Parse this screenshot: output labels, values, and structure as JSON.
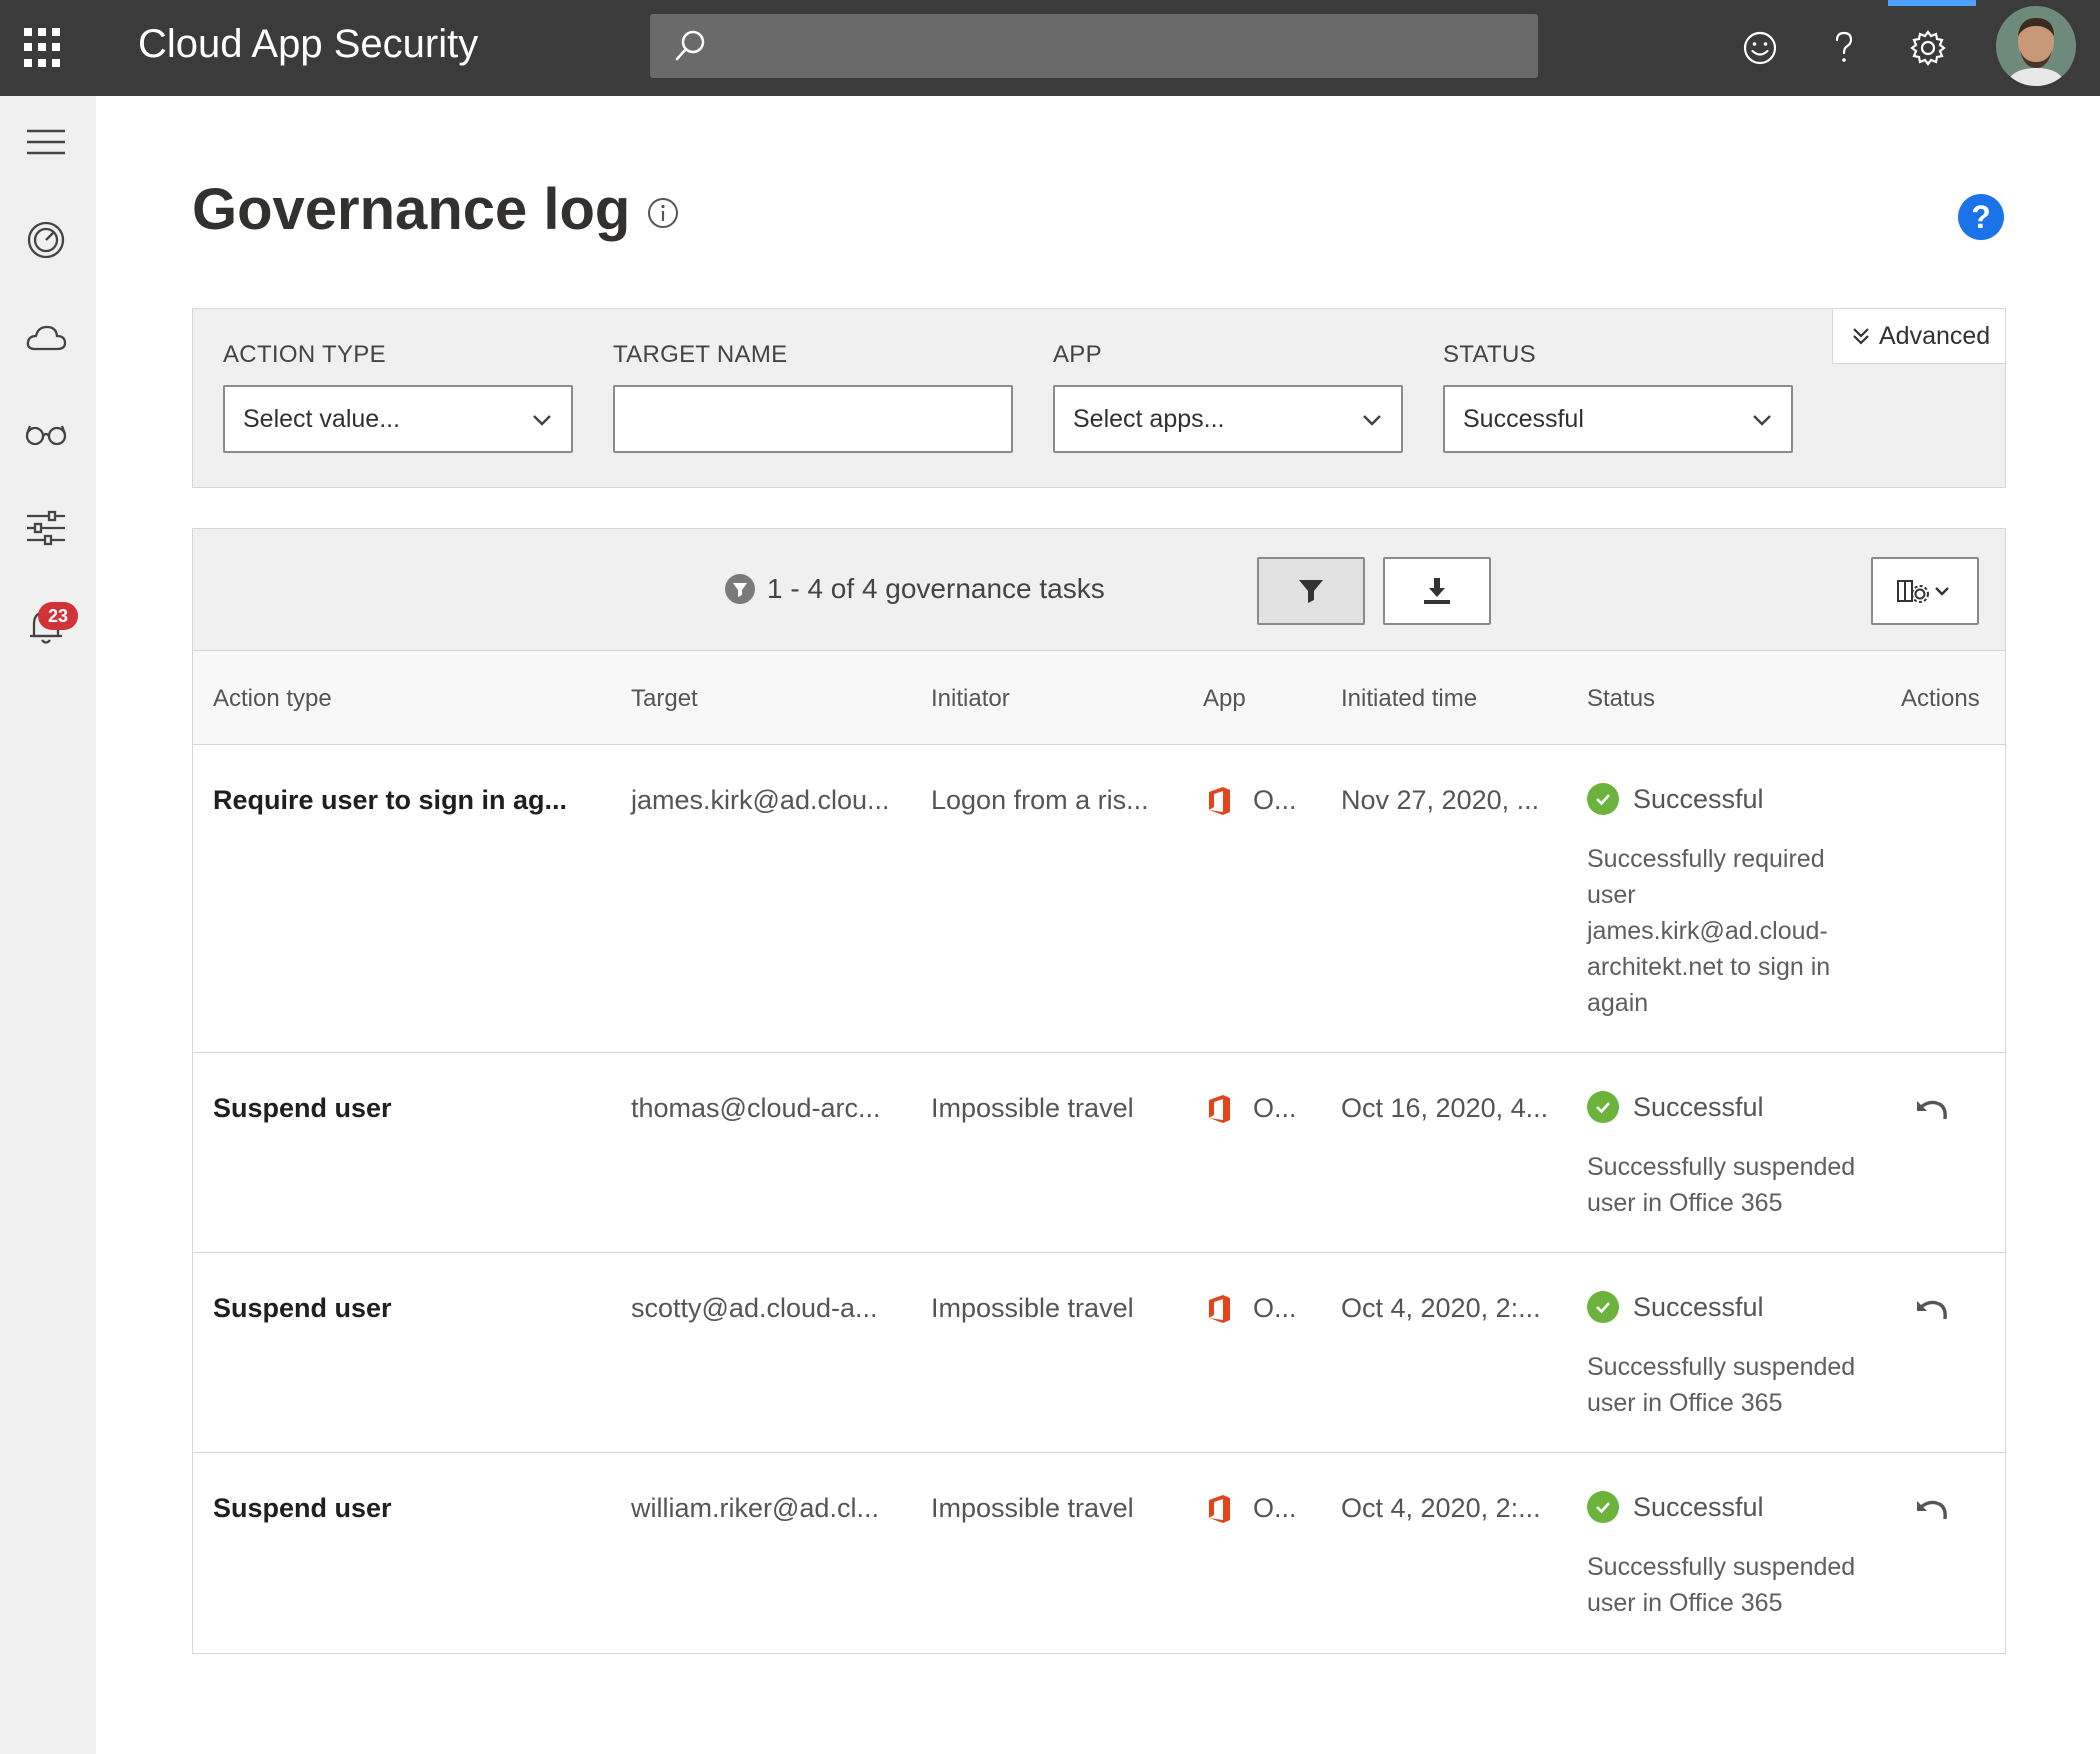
{
  "topbar": {
    "app_title": "Cloud App Security",
    "icons": [
      "app-launcher-icon",
      "search-icon",
      "smiley-feedback-icon",
      "question-icon",
      "gear-icon"
    ]
  },
  "siderail": {
    "icons": [
      "hamburger-menu-icon",
      "dashboard-gauge-icon",
      "cloud-icon",
      "glasses-icon",
      "sliders-icon",
      "bell-icon"
    ],
    "alerts_badge": "23"
  },
  "page": {
    "title": "Governance log"
  },
  "filters": {
    "action_type": {
      "label": "ACTION TYPE",
      "value": "Select value..."
    },
    "target_name": {
      "label": "TARGET NAME",
      "value": ""
    },
    "app": {
      "label": "APP",
      "value": "Select apps..."
    },
    "status": {
      "label": "STATUS",
      "value": "Successful"
    },
    "advanced_label": "Advanced"
  },
  "table": {
    "count_text": "1 - 4 of 4 governance tasks",
    "columns": [
      "Action type",
      "Target",
      "Initiator",
      "App",
      "Initiated time",
      "Status",
      "Actions"
    ],
    "rows": [
      {
        "action_type": "Require user to sign in ag...",
        "target": "james.kirk@ad.clou...",
        "initiator": "Logon from a ris...",
        "app": "O...",
        "time": "Nov 27, 2020, ...",
        "status": "Successful",
        "status_detail": "Successfully required user james.kirk@ad.cloud-architekt.net to sign in again"
      },
      {
        "action_type": "Suspend user",
        "target": "thomas@cloud-arc...",
        "initiator": "Impossible travel",
        "app": "O...",
        "time": "Oct 16, 2020, 4...",
        "status": "Successful",
        "status_detail": "Successfully suspended user in Office 365"
      },
      {
        "action_type": "Suspend user",
        "target": "scotty@ad.cloud-a...",
        "initiator": "Impossible travel",
        "app": "O...",
        "time": "Oct 4, 2020, 2:...",
        "status": "Successful",
        "status_detail": "Successfully suspended user in Office 365"
      },
      {
        "action_type": "Suspend user",
        "target": "william.riker@ad.cl...",
        "initiator": "Impossible travel",
        "app": "O...",
        "time": "Oct 4, 2020, 2:...",
        "status": "Successful",
        "status_detail": "Successfully suspended user in Office 365"
      }
    ]
  },
  "colors": {
    "topbar": "#3b3b3b",
    "accent_blue": "#1a73e8",
    "success_green": "#6bb33c",
    "office_red": "#e3441c",
    "badge_red": "#d13438"
  }
}
